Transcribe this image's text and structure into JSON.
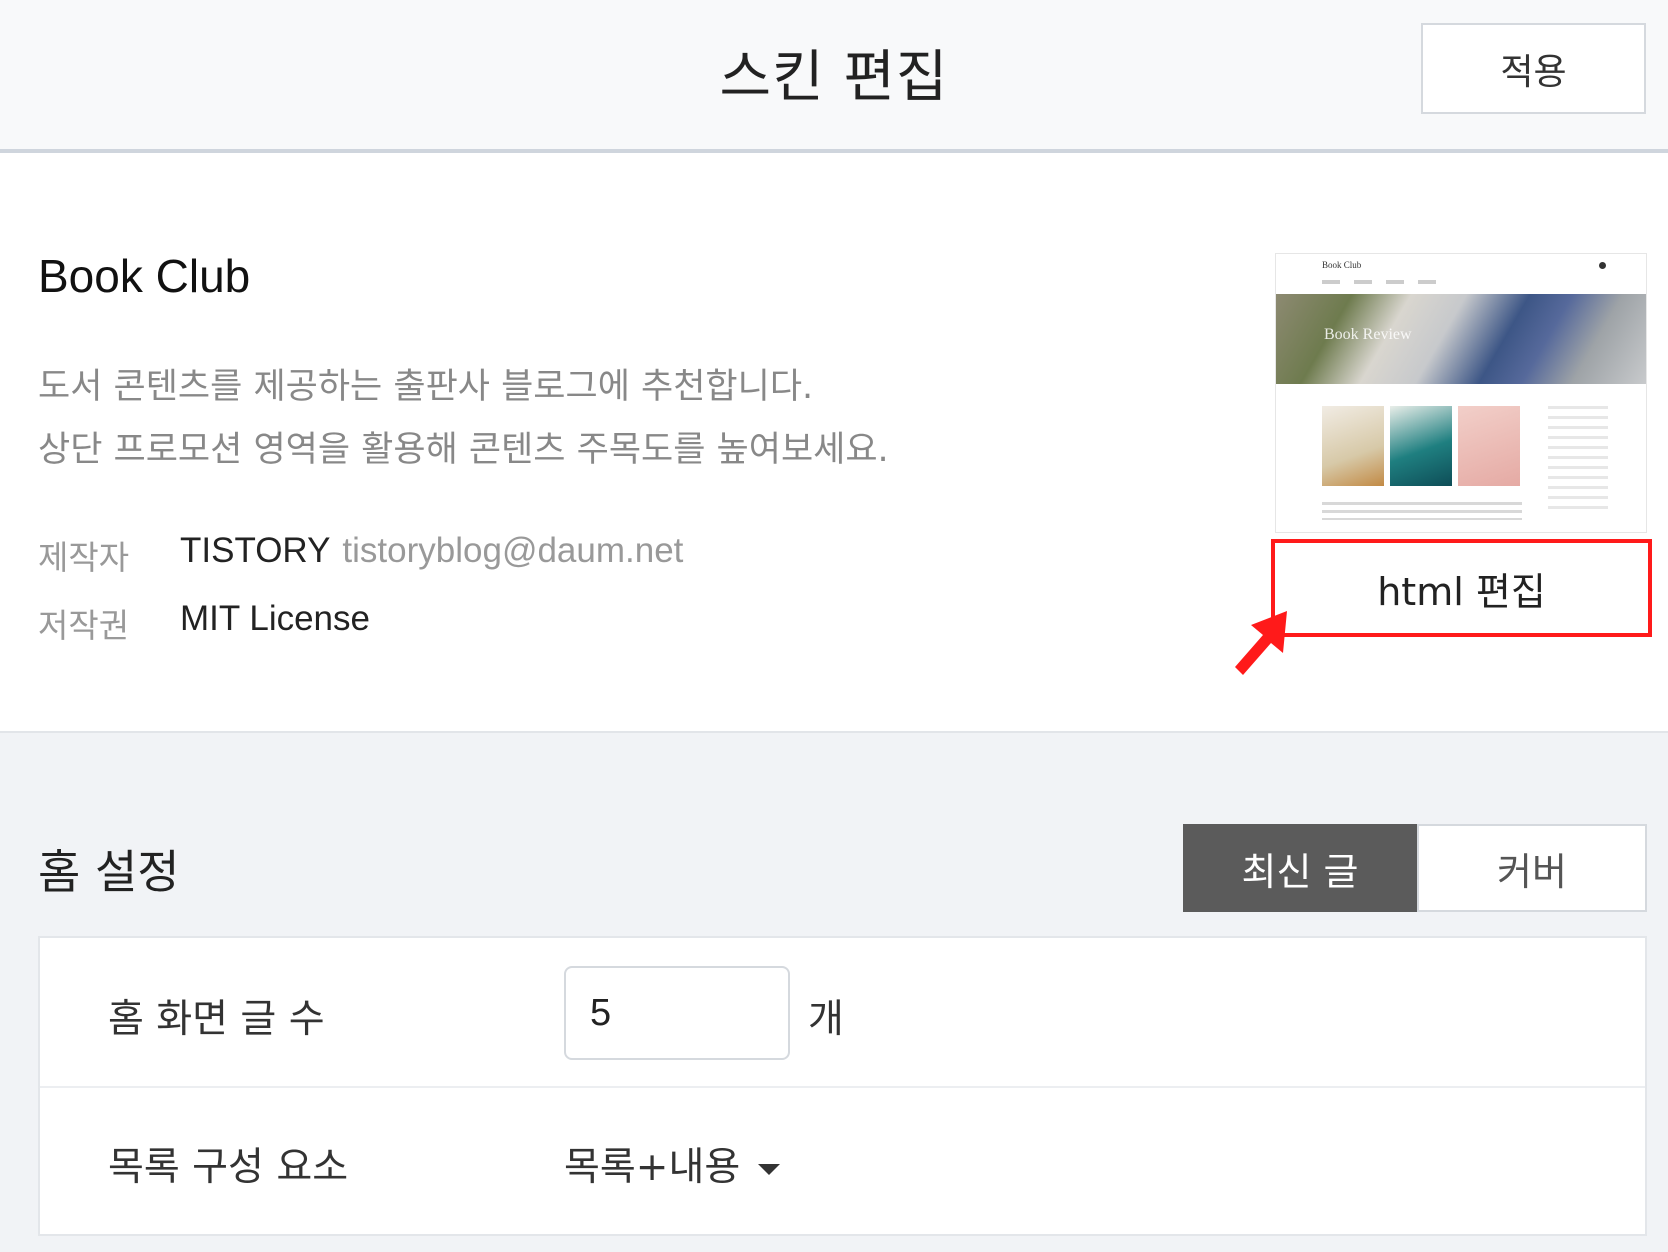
{
  "header": {
    "title": "스킨 편집",
    "apply_label": "적용"
  },
  "skin": {
    "name": "Book Club",
    "description_line1": "도서 콘텐츠를 제공하는 출판사 블로그에 추천합니다.",
    "description_line2": "상단 프로모션 영역을 활용해 콘텐츠 주목도를 높여보세요.",
    "author_label": "제작자",
    "author_name": "TISTORY",
    "author_email": "tistoryblog@daum.net",
    "license_label": "저작권",
    "license_value": "MIT License",
    "html_edit_label": "html 편집",
    "preview": {
      "title": "Book Club",
      "hero_text": "Book Review"
    }
  },
  "home_settings": {
    "title": "홈 설정",
    "tabs": [
      {
        "label": "최신 글",
        "active": true
      },
      {
        "label": "커버",
        "active": false
      }
    ],
    "post_count_label": "홈 화면 글 수",
    "post_count_value": "5",
    "post_count_unit": "개",
    "list_elements_label": "목록 구성 요소",
    "list_elements_value": "목록+내용"
  },
  "colors": {
    "highlight": "#ff1a1a",
    "active_tab": "#5b5b5b"
  }
}
